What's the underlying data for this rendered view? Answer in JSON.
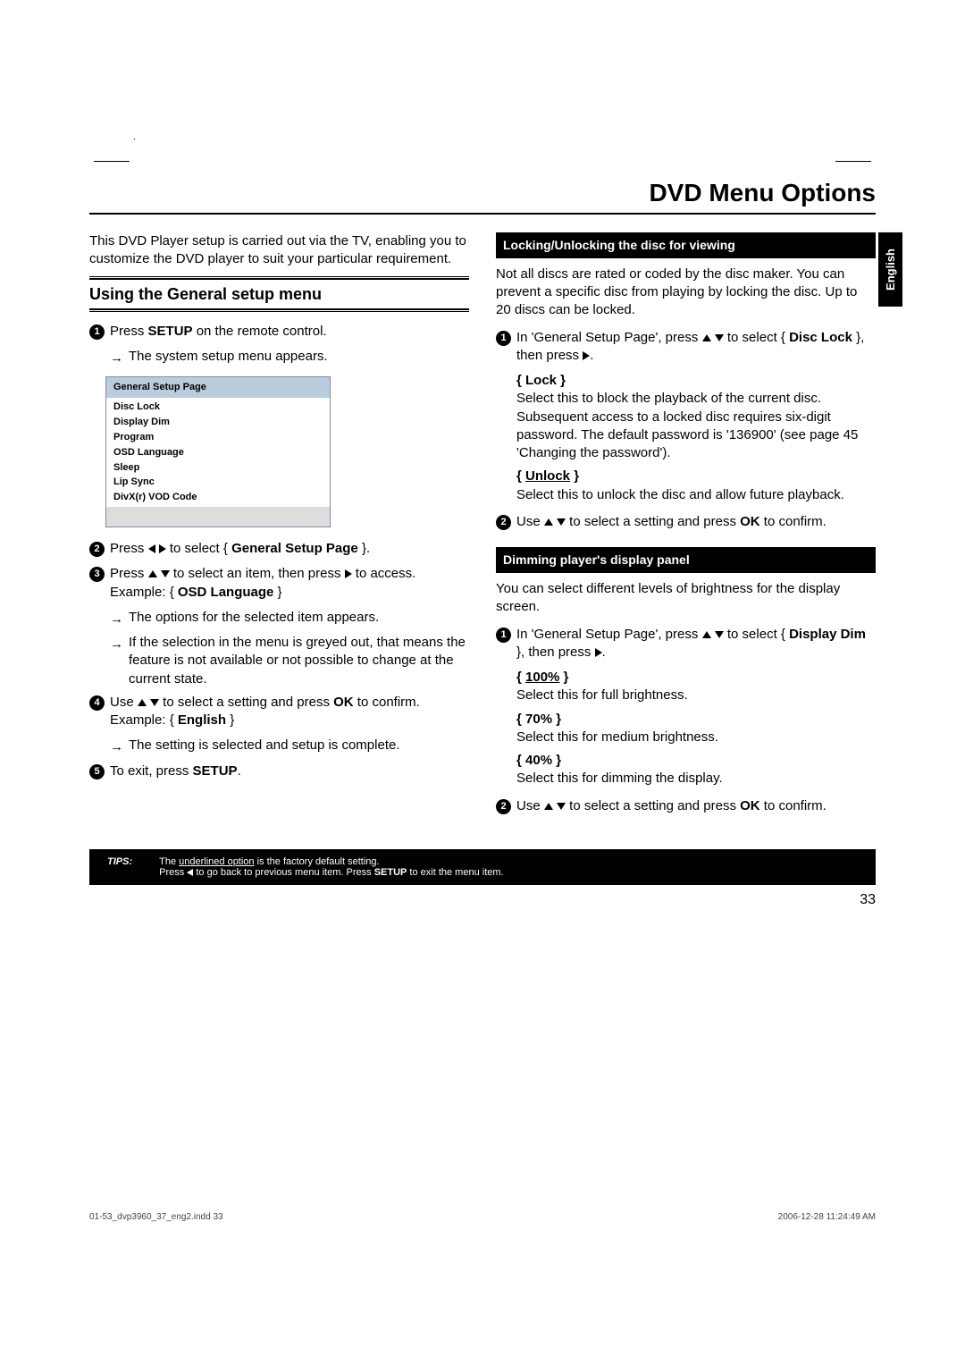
{
  "page_title": "DVD Menu Options",
  "side_tab": "English",
  "intro": "This DVD Player setup is carried out via the TV, enabling you to customize the DVD player to suit your particular requirement.",
  "section_general": {
    "title": "Using the General setup menu",
    "step1_a": "Press ",
    "step1_b": "SETUP",
    "step1_c": " on the remote control.",
    "step1_sub": "The system setup menu appears.",
    "menu_header": "General Setup Page",
    "menu_items": [
      "Disc Lock",
      "Display Dim",
      "Program",
      "OSD Language",
      "Sleep",
      "Lip Sync",
      "DivX(r) VOD Code"
    ],
    "step2_a": "Press ",
    "step2_b": " to select { ",
    "step2_c": "General Setup Page",
    "step2_d": " }.",
    "step3_a": "Press ",
    "step3_b": " to select an item, then press ",
    "step3_c": " to access.",
    "step3_ex_a": "Example: { ",
    "step3_ex_b": "OSD Language",
    "step3_ex_c": " }",
    "step3_sub1": "The options for the selected item appears.",
    "step3_sub2": "If the selection in the menu is greyed out, that means the feature is not available or not possible to change at the current state.",
    "step4_a": "Use ",
    "step4_b": " to select a setting and press ",
    "step4_c": "OK",
    "step4_d": " to confirm.",
    "step4_ex_a": "Example: { ",
    "step4_ex_b": "English",
    "step4_ex_c": " }",
    "step4_sub": "The setting is selected and setup is complete.",
    "step5_a": "To exit, press ",
    "step5_b": "SETUP",
    "step5_c": "."
  },
  "section_lock": {
    "heading": "Locking/Unlocking the disc for viewing",
    "intro": "Not all discs are rated or coded by the disc maker. You can prevent a specific disc from playing by locking the disc. Up to 20 discs can be locked.",
    "step1_a": "In 'General Setup Page', press ",
    "step1_b": " to select { ",
    "step1_c": "Disc Lock",
    "step1_d": " }, then press ",
    "step1_e": ".",
    "opt_lock_label": "{ Lock }",
    "opt_lock_desc": "Select this to block the playback of the current disc. Subsequent access to a locked disc requires six-digit password. The default password is '136900' (see page 45 'Changing the password').",
    "opt_unlock_label_a": "{ ",
    "opt_unlock_label_b": "Unlock",
    "opt_unlock_label_c": " }",
    "opt_unlock_desc": "Select this to unlock the disc and allow future playback.",
    "step2_a": "Use ",
    "step2_b": " to select a setting and press ",
    "step2_c": "OK",
    "step2_d": " to confirm."
  },
  "section_dim": {
    "heading": "Dimming player's display panel",
    "intro": "You can select different levels of brightness for the display screen.",
    "step1_a": "In 'General Setup Page', press ",
    "step1_b": " to select { ",
    "step1_c": "Display Dim",
    "step1_d": " }, then press ",
    "step1_e": ".",
    "opt100_label_a": "{ ",
    "opt100_label_b": "100%",
    "opt100_label_c": " }",
    "opt100_desc": "Select this for full brightness.",
    "opt70_label": "{ 70% }",
    "opt70_desc": "Select this for medium brightness.",
    "opt40_label": "{ 40% }",
    "opt40_desc": "Select this for dimming the display.",
    "step2_a": "Use ",
    "step2_b": " to select a setting and press ",
    "step2_c": "OK",
    "step2_d": " to confirm."
  },
  "tips": {
    "label": "TIPS:",
    "line1_a": "The ",
    "line1_b": "underlined option",
    "line1_c": " is the factory default setting.",
    "line2_a": "Press ",
    "line2_b": " to go back to previous menu item. Press ",
    "line2_c": "SETUP",
    "line2_d": " to exit the menu item."
  },
  "page_number": "33",
  "footer": {
    "left": "01-53_dvp3960_37_eng2.indd   33",
    "right": "2006-12-28   11:24:49 AM"
  }
}
